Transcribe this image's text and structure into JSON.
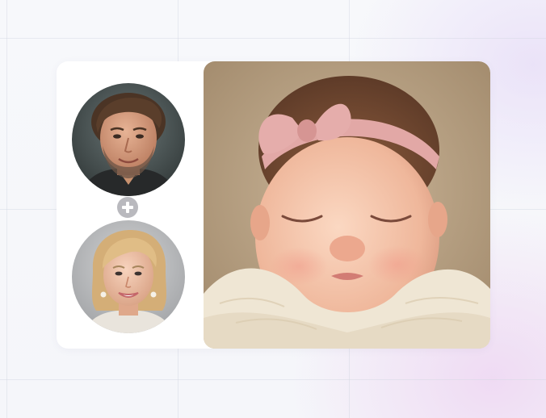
{
  "scene": {
    "parents": [
      {
        "role": "father",
        "icon": "man-portrait"
      },
      {
        "role": "mother",
        "icon": "woman-portrait"
      }
    ],
    "combine_icon": "plus-icon",
    "result": {
      "icon": "sleeping-baby-with-pink-bow"
    }
  },
  "colors": {
    "plus_badge": "#b9b9be",
    "headband": "#e2a8a6",
    "swaddle": "#efe6d4",
    "backdrop": "#bba487"
  }
}
